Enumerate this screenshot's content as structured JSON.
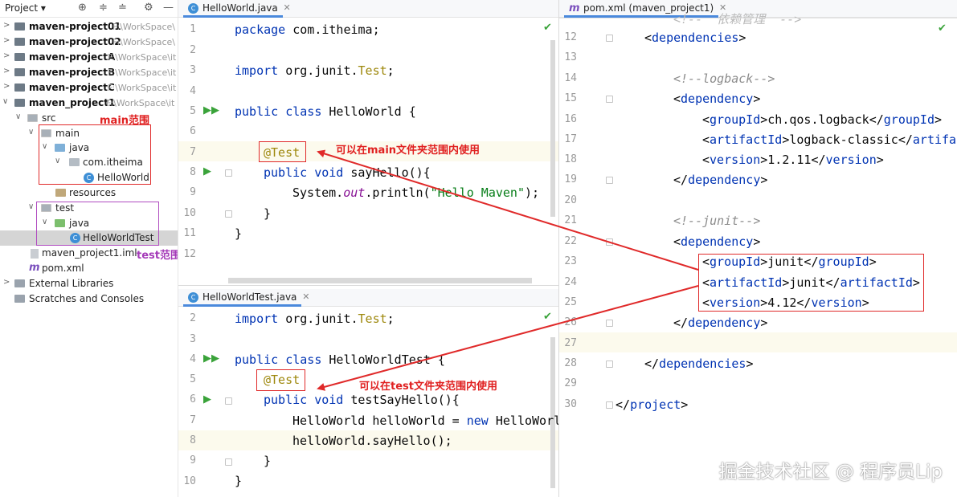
{
  "sidebar": {
    "title": "Project",
    "toolbar_icons": [
      "add-target-icon",
      "expand-all-icon",
      "collapse-all-icon",
      "gear-icon",
      "minimize-icon"
    ],
    "items": [
      {
        "label": "maven-project01",
        "path": "F:\\WorkSpace\\",
        "depth": 0,
        "arrow": ">",
        "bold": true
      },
      {
        "label": "maven-project02",
        "path": "F:\\WorkSpace\\",
        "depth": 0,
        "arrow": ">",
        "bold": true
      },
      {
        "label": "maven-projectA",
        "path": "F:\\WorkSpace\\it",
        "depth": 0,
        "arrow": ">",
        "bold": true
      },
      {
        "label": "maven-projectB",
        "path": "F:\\WorkSpace\\it",
        "depth": 0,
        "arrow": ">",
        "bold": true
      },
      {
        "label": "maven-projectC",
        "path": "F:\\WorkSpace\\it",
        "depth": 0,
        "arrow": ">",
        "bold": true
      },
      {
        "label": "maven_project1",
        "path": "F:\\WorkSpace\\it",
        "depth": 0,
        "arrow": "v",
        "bold": true
      },
      {
        "label": "src",
        "depth": 1
      },
      {
        "label": "main",
        "depth": 2
      },
      {
        "label": "java",
        "depth": 3
      },
      {
        "label": "com.itheima",
        "depth": 4
      },
      {
        "label": "HelloWorld",
        "depth": 5
      },
      {
        "label": "resources",
        "depth": 3
      },
      {
        "label": "test",
        "depth": 2
      },
      {
        "label": "java",
        "depth": 3
      },
      {
        "label": "HelloWorldTest",
        "depth": 4
      },
      {
        "label": "maven_project1.iml",
        "depth": 2
      },
      {
        "label": "pom.xml",
        "depth": 2
      },
      {
        "label": "External Libraries",
        "depth": 0
      },
      {
        "label": "Scratches and Consoles",
        "depth": 0
      }
    ],
    "notes": {
      "main": "main范围",
      "test": "test范围"
    }
  },
  "editor_main": {
    "tab": "HelloWorld.java",
    "line_numbers": [
      "1",
      "2",
      "3",
      "4",
      "5",
      "6",
      "7",
      "8",
      "9",
      "10",
      "11",
      "12"
    ],
    "lines": {
      "l1_kw": "package",
      "l1_rest": " com.itheima;",
      "l3_kw": "import",
      "l3_pre": " org.junit.",
      "l3_ann": "Test",
      "l3_post": ";",
      "l5_kw": "public class",
      "l5_rest": " HelloWorld {",
      "l7_ann": "@Test",
      "l8_kw": "public void",
      "l8_rest": " sayHello(){",
      "l9_pre": "System.",
      "l9_ital": "out",
      "l9_mid": ".println(",
      "l9_str": "\"Hello Maven\"",
      "l9_post": ");",
      "l10": "}",
      "l11": "}"
    },
    "annotation": "可以在main文件夹范围内使用"
  },
  "editor_test": {
    "tab": "HelloWorldTest.java",
    "line_numbers": [
      "2",
      "3",
      "4",
      "5",
      "6",
      "7",
      "8",
      "9",
      "10"
    ],
    "lines": {
      "l2_kw": "import",
      "l2_pre": " org.junit.",
      "l2_ann": "Test",
      "l2_post": ";",
      "l4_kw": "public class",
      "l4_rest": " HelloWorldTest {",
      "l5_ann": "@Test",
      "l6_kw": "public void",
      "l6_rest": " testSayHello(){",
      "l7_pre": "HelloWorld helloWorld = ",
      "l7_kw": "new",
      "l7_post": " HelloWorl",
      "l8": "helloWorld.sayHello();",
      "l9": "}",
      "l10": "}"
    },
    "annotation": "可以在test文件夹范围内使用"
  },
  "editor_pom": {
    "tab": "pom.xml (maven_project1)",
    "line_numbers": [
      "12",
      "13",
      "14",
      "15",
      "16",
      "17",
      "18",
      "19",
      "20",
      "21",
      "22",
      "23",
      "24",
      "25",
      "26",
      "27",
      "28",
      "29",
      "30"
    ],
    "lines": {
      "top_partial": "<!--  依赖管理  -->",
      "l12": [
        "<",
        "dependencies",
        ">"
      ],
      "l14": "<!--logback-->",
      "l15": [
        "<",
        "dependency",
        ">"
      ],
      "l16": [
        "<",
        "groupId",
        ">ch.qos.logback</",
        "groupId",
        ">"
      ],
      "l17": [
        "<",
        "artifactId",
        ">logback-classic</",
        "artifa"
      ],
      "l18": [
        "<",
        "version",
        ">1.2.11</",
        "version",
        ">"
      ],
      "l19": [
        "</",
        "dependency",
        ">"
      ],
      "l21": "<!--junit-->",
      "l22": [
        "<",
        "dependency",
        ">"
      ],
      "l23": [
        "<",
        "groupId",
        ">junit</",
        "groupId",
        ">"
      ],
      "l24": [
        "<",
        "artifactId",
        ">junit</",
        "artifactId",
        ">"
      ],
      "l25": [
        "<",
        "version",
        ">4.12</",
        "version",
        ">"
      ],
      "l26": [
        "</",
        "dependency",
        ">"
      ],
      "l28": [
        "</",
        "dependencies",
        ">"
      ],
      "l30": [
        "</",
        "project",
        ">"
      ]
    }
  },
  "watermark": "掘金技术社区 @ 程序员Lip",
  "colors": {
    "keyword": "#0033b3",
    "annotation": "#9e880d",
    "string": "#067d17",
    "highlight_box": "#e02a2a",
    "test_box": "#b04cc0",
    "run_icon": "#3aa33a"
  }
}
